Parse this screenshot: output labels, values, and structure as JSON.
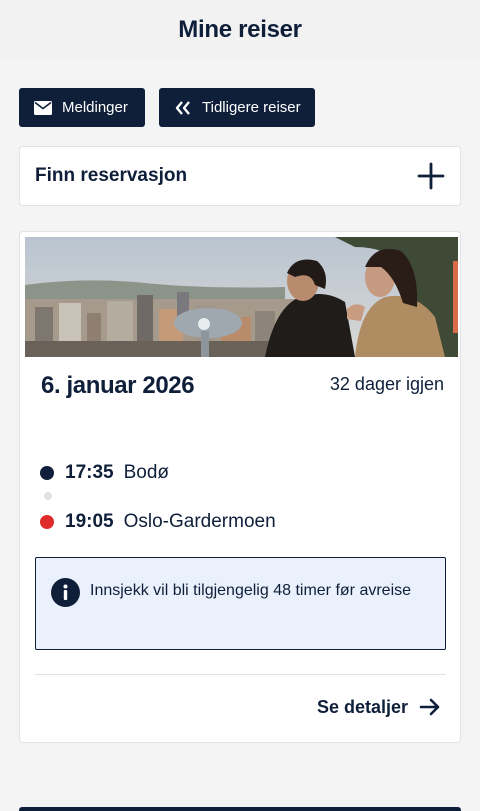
{
  "header": {
    "title": "Mine reiser"
  },
  "actions": {
    "messages_label": "Meldinger",
    "previous_label": "Tidligere reiser"
  },
  "find_reservation": {
    "label": "Finn reservasjon"
  },
  "trip": {
    "date": "6. januar 2026",
    "remaining": "32 dager igjen",
    "departure": {
      "time": "17:35",
      "place": "Bodø"
    },
    "arrival": {
      "time": "19:05",
      "place": "Oslo-Gardermoen"
    },
    "info_text": "Innsjekk vil bli tilgjengelig 48 timer før avreise",
    "details_label": "Se detaljer"
  },
  "colors": {
    "navy": "#0f1f3a",
    "departure_dot": "#0f1f3a",
    "arrival_dot": "#e02b2b",
    "info_bg": "#eaf1fd"
  },
  "icons": {
    "messages": "envelope-icon",
    "previous": "double-chevron-left-icon",
    "add": "plus-icon",
    "info": "info-icon",
    "details": "arrow-right-icon"
  }
}
